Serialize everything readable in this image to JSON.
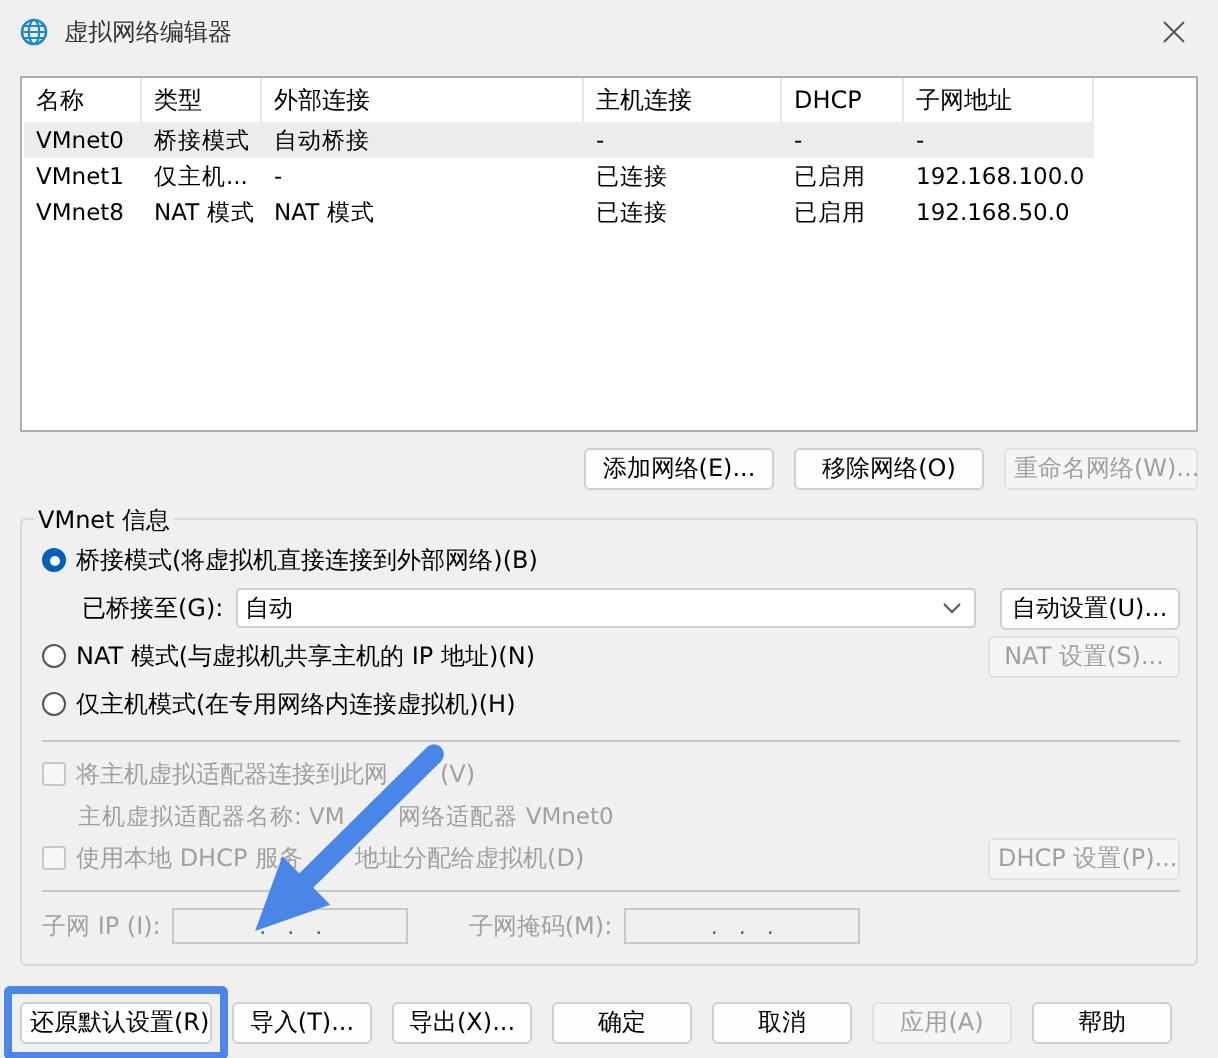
{
  "window": {
    "title": "虚拟网络编辑器"
  },
  "table": {
    "columns": [
      "名称",
      "类型",
      "外部连接",
      "主机连接",
      "DHCP",
      "子网地址"
    ],
    "rows": [
      {
        "cells": [
          "VMnet0",
          "桥接模式",
          "自动桥接",
          "-",
          "-",
          "-"
        ],
        "selected": true
      },
      {
        "cells": [
          "VMnet1",
          "仅主机...",
          "-",
          "已连接",
          "已启用",
          "192.168.100.0"
        ],
        "selected": false
      },
      {
        "cells": [
          "VMnet8",
          "NAT 模式",
          "NAT 模式",
          "已连接",
          "已启用",
          "192.168.50.0"
        ],
        "selected": false
      }
    ]
  },
  "list_buttons": [
    {
      "label": "添加网络(E)...",
      "disabled": false
    },
    {
      "label": "移除网络(O)",
      "disabled": false
    },
    {
      "label": "重命名网络(W)...",
      "disabled": true
    }
  ],
  "vmnet_info": {
    "title": "VMnet 信息",
    "modes": [
      {
        "kind": "bridged",
        "label": "桥接模式(将虚拟机直接连接到外部网络)(B)",
        "selected": true,
        "bridged_label": "已桥接至(G):",
        "bridged_value": "自动",
        "button": {
          "label": "自动设置(U)...",
          "disabled": false
        }
      },
      {
        "kind": "nat",
        "label": "NAT 模式(与虚拟机共享主机的 IP 地址)(N)",
        "selected": false,
        "button": {
          "label": "NAT 设置(S)...",
          "disabled": true
        }
      },
      {
        "kind": "hostonly",
        "label": "仅主机模式(在专用网络内连接虚拟机)(H)",
        "selected": false
      }
    ],
    "options": [
      {
        "kind": "adapter",
        "label_parts": [
          "将主机虚拟适配器连接到此网",
          "(V)"
        ],
        "checked": false,
        "disabled": true,
        "detail_parts": [
          "主机虚拟适配器名称: VM",
          "网络适配器 VMnet0"
        ]
      },
      {
        "kind": "dhcp",
        "label_parts": [
          "使用本地 DHCP 服务",
          "地址分配给虚拟机(D)"
        ],
        "checked": false,
        "disabled": true,
        "button": {
          "label": "DHCP 设置(P)...",
          "disabled": true
        }
      }
    ],
    "subnet_ip": {
      "label": "子网 IP (I):",
      "value": ".   .   ."
    },
    "subnet_mask": {
      "label": "子网掩码(M):",
      "value": ".   .   ."
    }
  },
  "footer_buttons": [
    {
      "label": "还原默认设置(R)",
      "disabled": false,
      "highlighted": true
    },
    {
      "label": "导入(T)...",
      "disabled": false,
      "highlighted": false
    },
    {
      "label": "导出(X)...",
      "disabled": false,
      "highlighted": false
    },
    {
      "label": "确定",
      "disabled": false,
      "highlighted": false
    },
    {
      "label": "取消",
      "disabled": false,
      "highlighted": false
    },
    {
      "label": "应用(A)",
      "disabled": true,
      "highlighted": false
    },
    {
      "label": "帮助",
      "disabled": false,
      "highlighted": false
    }
  ],
  "annotation": {
    "kind": "arrow"
  }
}
